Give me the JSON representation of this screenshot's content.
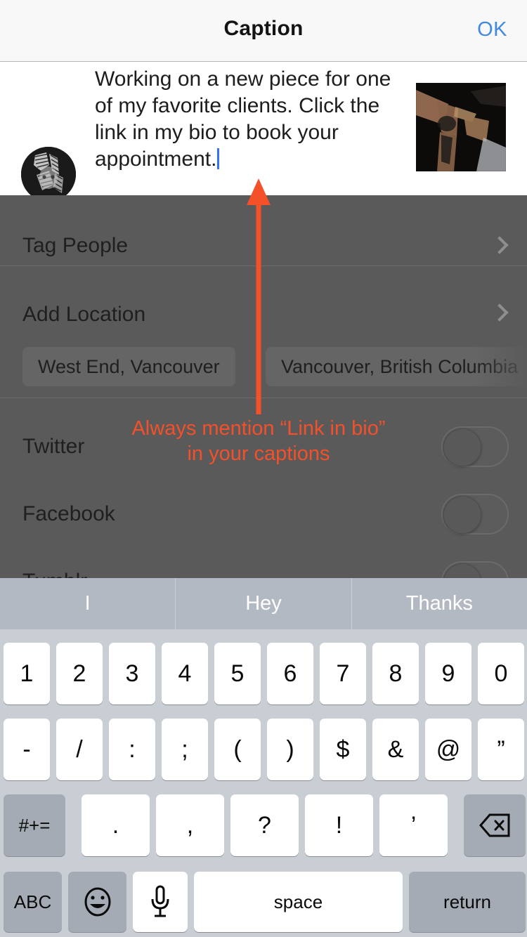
{
  "header": {
    "title": "Caption",
    "ok_label": "OK",
    "ok_color": "#3f8ae0"
  },
  "composer": {
    "avatar_name": "user-avatar",
    "caption_text": "Working on a new piece for one of my favorite clients. Click the link in my bio to book your appointment.",
    "cursor_visible": true,
    "post_thumbnail_name": "post-thumbnail"
  },
  "options": {
    "tag_people": "Tag People",
    "add_location": "Add Location",
    "location_chips": [
      "West End, Vancouver",
      "Vancouver, British Columbia"
    ],
    "social": [
      {
        "label": "Twitter",
        "enabled": false
      },
      {
        "label": "Facebook",
        "enabled": false
      },
      {
        "label": "Tumblr",
        "enabled": false
      }
    ]
  },
  "annotation": {
    "line1": "Always mention “Link in bio”",
    "line2": "in your captions",
    "color": "#f4502a"
  },
  "keyboard": {
    "suggestions": [
      "I",
      "Hey",
      "Thanks"
    ],
    "row_numbers": [
      "1",
      "2",
      "3",
      "4",
      "5",
      "6",
      "7",
      "8",
      "9",
      "0"
    ],
    "row_symbols": [
      "-",
      "/",
      ":",
      ";",
      "(",
      ")",
      "$",
      "&",
      "@",
      "”"
    ],
    "row_punct": [
      ".",
      ",",
      "?",
      "!",
      "’"
    ],
    "symbols_key": "#+=",
    "delete_key_name": "delete-icon",
    "abc_key": "ABC",
    "emoji_key_name": "emoji-icon",
    "mic_key_name": "microphone-icon",
    "space_key": "space",
    "return_key": "return"
  }
}
